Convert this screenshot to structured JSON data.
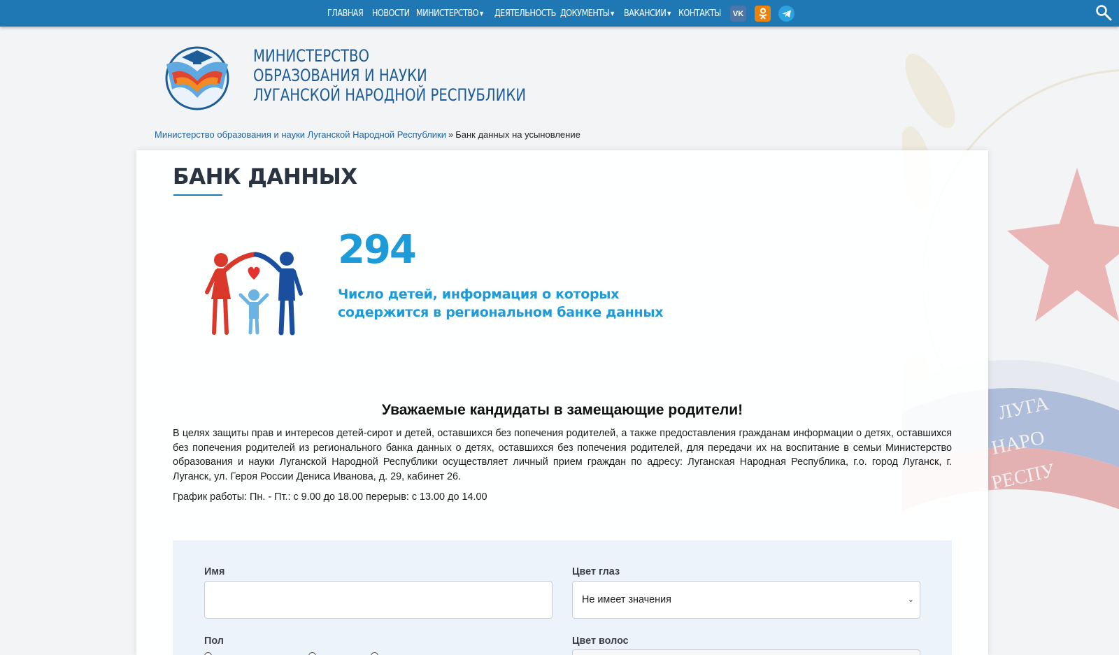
{
  "nav": {
    "items": [
      {
        "label": "ГЛАВНАЯ",
        "dropdown": false
      },
      {
        "label": "НОВОСТИ",
        "dropdown": false
      },
      {
        "label": "МИНИСТЕРСТВО",
        "dropdown": true
      },
      {
        "label": "ДЕЯТЕЛЬНОСТЬ",
        "dropdown": false
      },
      {
        "label": "ДОКУМЕНТЫ",
        "dropdown": true
      },
      {
        "label": "ВАКАНСИИ",
        "dropdown": true
      },
      {
        "label": "КОНТАКТЫ",
        "dropdown": false
      }
    ],
    "social": {
      "vk": "VK",
      "ok": "ОК"
    },
    "colors": {
      "bar": "#1f78b4",
      "vk": "#4a76a8",
      "ok": "#ee8208",
      "telegram": "#2aa3df"
    }
  },
  "header": {
    "org_line1": "МИНИСТЕРСТВО",
    "org_line2": "ОБРАЗОВАНИЯ И НАУКИ",
    "org_line3": "ЛУГАНСКОЙ НАРОДНОЙ РЕСПУБЛИКИ"
  },
  "breadcrumb": {
    "home": "Министерство образования и науки Луганской Народной Республики",
    "separator": "»",
    "current": "Банк данных на усыновление"
  },
  "page": {
    "title": "БАНК ДАННЫХ",
    "count": "294",
    "count_caption_line1": "Число детей, информация о которых",
    "count_caption_line2": "содержится в региональном банке данных",
    "greeting": "Уважаемые кандидаты в замещающие родители!",
    "info": "В целях защиты прав и интересов детей-сирот и детей, оставшихся без попечения родителей, а также предоставления гражданам информации о детях, оставшихся без попечения родителей из регионального банка данных о детях, оставшихся без попечения родителей, для передачи их на воспитание в семьи Министерство образования и науки Луганской Народной Республики осуществляет личный прием граждан по адресу: Луганская Народная Республика, г.о. город Луганск, г. Луганск, ул. Героя России Дениса Иванова, д. 29, кабинет 26.",
    "schedule": "График работы: Пн. - Пт.: с 9.00 до 18.00 перерыв: с 13.00 до 14.00"
  },
  "form": {
    "name_label": "Имя",
    "name_value": "",
    "eye_label": "Цвет глаз",
    "eye_selected": "Не имеет значения",
    "gender_label": "Пол",
    "hair_label": "Цвет волос"
  }
}
